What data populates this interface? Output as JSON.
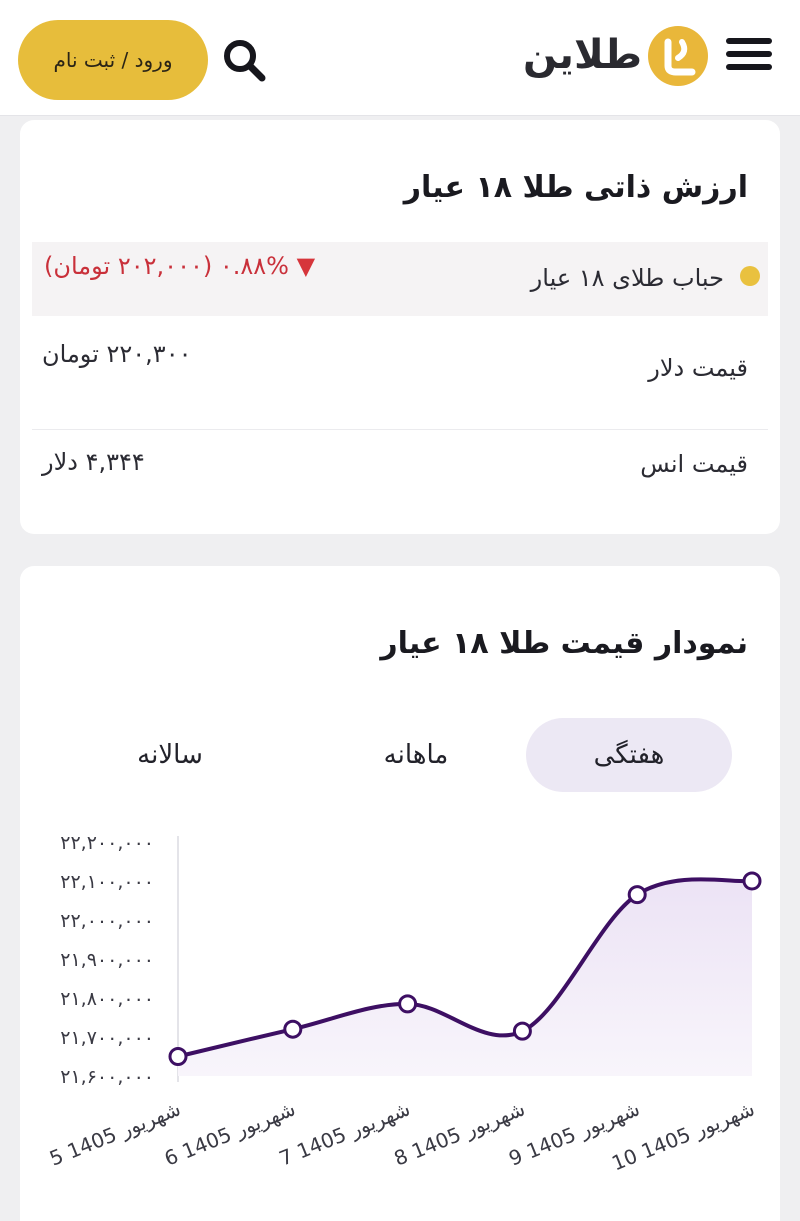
{
  "header": {
    "logo_text": "طلاین",
    "login_label": "ورود / ثبت نام"
  },
  "intrinsic": {
    "title": "ارزش ذاتی طلا ۱۸ عیار",
    "bubble_label": "حباب طلای ۱۸ عیار",
    "bubble_value": "۰.۸۸% (۲۰۲,۰۰۰ تومان)",
    "dollar_label": "قیمت دلار",
    "dollar_value": "۲۲۰,۳۰۰ تومان",
    "ounce_label": "قیمت انس",
    "ounce_value": "۴,۳۴۴ دلار"
  },
  "chart_section": {
    "title": "نمودار قیمت طلا ۱۸ عیار",
    "tabs": [
      {
        "label": "هفتگی",
        "active": true
      },
      {
        "label": "ماهانه",
        "active": false
      },
      {
        "label": "سالانه",
        "active": false
      }
    ]
  },
  "colors": {
    "accent": "#e7bd3b",
    "line": "#3d0f63",
    "negative": "#c9303a"
  },
  "chart_data": {
    "type": "area",
    "categories": [
      "5 شهریور 1405",
      "6 شهریور 1405",
      "7 شهریور 1405",
      "8 شهریور 1405",
      "9 شهریور 1405",
      "10 شهریور 1405"
    ],
    "values": [
      21650000,
      21720000,
      21785000,
      21715000,
      22065000,
      22100000
    ],
    "ylim": [
      21600000,
      22200000
    ],
    "yticks": [
      "۲۱,۶۰۰,۰۰۰",
      "۲۱,۷۰۰,۰۰۰",
      "۲۱,۸۰۰,۰۰۰",
      "۲۱,۹۰۰,۰۰۰",
      "۲۲,۰۰۰,۰۰۰",
      "۲۲,۱۰۰,۰۰۰",
      "۲۲,۲۰۰,۰۰۰"
    ],
    "grid": false,
    "legend": "none"
  }
}
